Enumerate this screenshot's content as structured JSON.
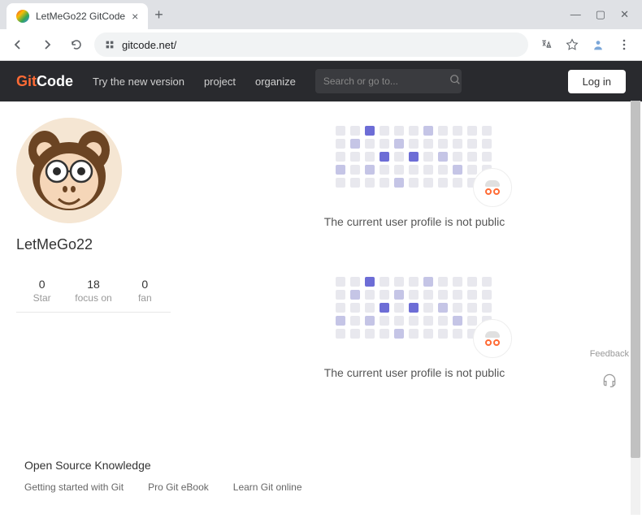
{
  "browser": {
    "tab_title": "LetMeGo22 GitCode",
    "url": "gitcode.net/"
  },
  "navbar": {
    "logo_git": "Git",
    "logo_code": "Code",
    "try_new": "Try the new version",
    "project": "project",
    "organize": "organize",
    "search_placeholder": "Search or go to...",
    "login": "Log in"
  },
  "profile": {
    "username": "LetMeGo22",
    "stats": [
      {
        "num": "0",
        "label": "Star"
      },
      {
        "num": "18",
        "label": "focus on"
      },
      {
        "num": "0",
        "label": "fan"
      }
    ]
  },
  "empty": {
    "message": "The current user profile is not public"
  },
  "footer": {
    "title": "Open Source Knowledge",
    "links": [
      "Getting started with Git",
      "Pro Git eBook",
      "Learn Git online"
    ]
  },
  "feedback_label": "Feedback"
}
